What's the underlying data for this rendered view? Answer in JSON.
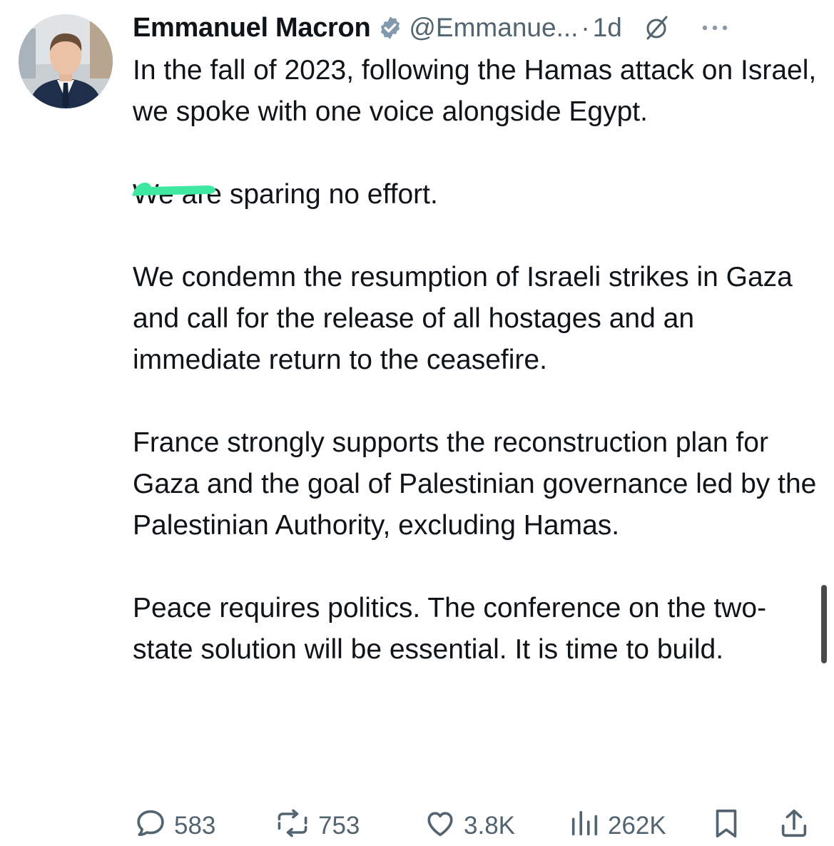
{
  "tweet": {
    "author_name": "Emmanuel Macron",
    "verified": true,
    "handle": "@Emmanue...",
    "separator": "·",
    "time": "1d",
    "avatar_icon": "profile-photo",
    "grok_icon": "grok-slash-circle-icon",
    "more_icon": "more-dots-icon",
    "paragraphs": [
      "In the fall of 2023, following the Hamas attack on Israel, we spoke with one voice alongside Egypt.",
      "We are sparing no effort.",
      "We condemn the resumption of Israeli strikes in Gaza and call for the release of all hostages and an immediate return to the ceasefire.",
      "France strongly supports the reconstruction plan for Gaza and the goal of Palestinian governance led by the Palestinian Authority, excluding Hamas.",
      "Peace requires politics. The conference on the two-state solution will be essential. It is time to build."
    ],
    "highlight_color": "#3ee8a0"
  },
  "actions": {
    "replies": "583",
    "reposts": "753",
    "likes": "3.8K",
    "views": "262K",
    "bookmark_icon": "bookmark-icon",
    "share_icon": "share-icon"
  },
  "colors": {
    "text": "#0f1419",
    "secondary": "#536471",
    "verified_badge": "#829aab"
  }
}
